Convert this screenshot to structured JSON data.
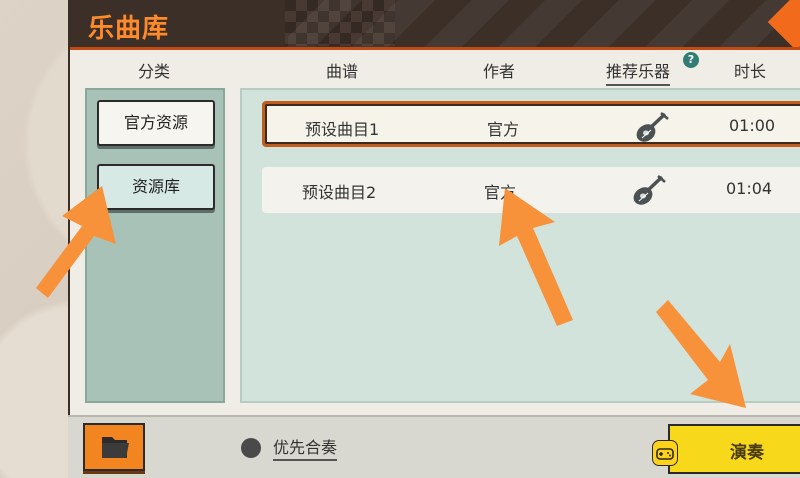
{
  "window": {
    "title": "乐曲库"
  },
  "columns": {
    "category": "分类",
    "score": "曲谱",
    "author": "作者",
    "recommended_instrument": "推荐乐器",
    "duration": "时长",
    "help_mark": "?"
  },
  "categories": [
    {
      "label": "官方资源",
      "active": false
    },
    {
      "label": "资源库",
      "active": true
    }
  ],
  "songs": [
    {
      "name": "预设曲目1",
      "author": "官方",
      "instrument": "lute-icon",
      "duration": "01:00",
      "selected": true
    },
    {
      "name": "预设曲目2",
      "author": "官方",
      "instrument": "lute-icon",
      "duration": "01:04",
      "selected": false
    }
  ],
  "footer": {
    "ensemble_toggle_label": "优先合奏",
    "play_button_label": "演奏"
  },
  "colors": {
    "title_text": "#ff8a2a",
    "title_bar": "#3b2f28",
    "accent_orange": "#f28520",
    "play_button": "#f7d81a",
    "annotation_arrow": "#f7913a"
  },
  "icons": {
    "folder": "folder-icon",
    "instrument": "lute-icon",
    "gamepad": "gamepad-icon",
    "help": "help-icon"
  }
}
